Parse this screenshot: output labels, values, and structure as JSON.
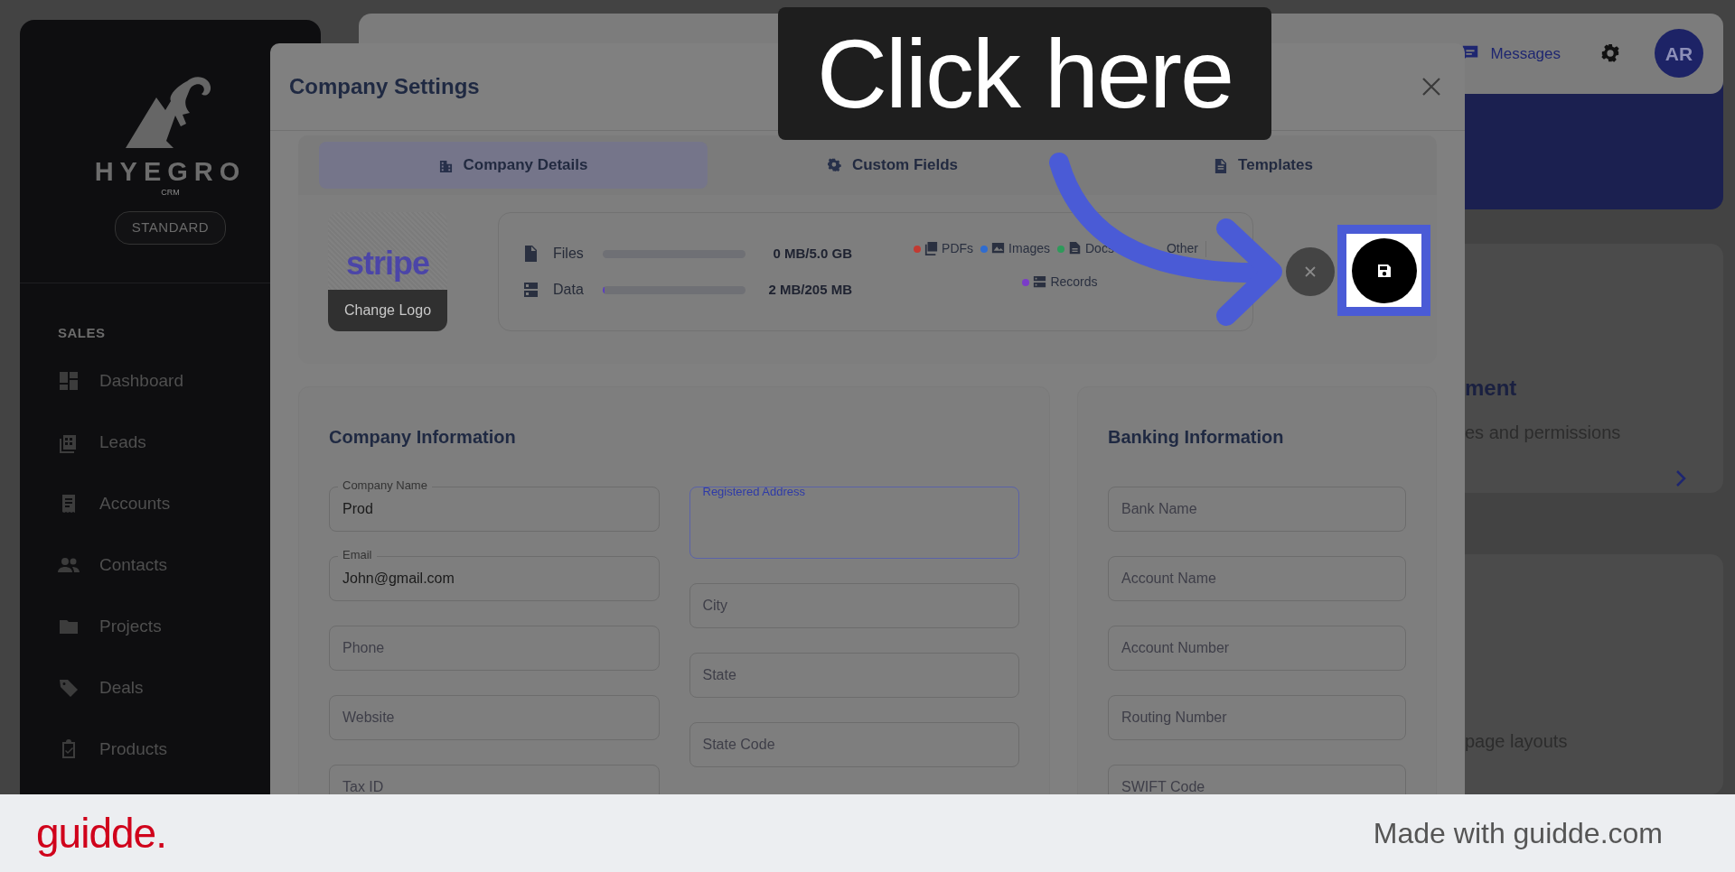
{
  "sidebar": {
    "logo": "HYEGRO",
    "logo_sub": "CRM",
    "plan": "STANDARD",
    "section": "SALES",
    "items": [
      {
        "label": "Dashboard"
      },
      {
        "label": "Leads"
      },
      {
        "label": "Accounts"
      },
      {
        "label": "Contacts"
      },
      {
        "label": "Projects"
      },
      {
        "label": "Deals"
      },
      {
        "label": "Products"
      }
    ]
  },
  "header": {
    "messages": "Messages",
    "avatar": "AR"
  },
  "background_cards": [
    {
      "title": "ment",
      "subtitle": "es and permissions"
    },
    {
      "subtitle": "page layouts"
    }
  ],
  "modal": {
    "title": "Company Settings",
    "tabs": [
      {
        "label": "Company Details",
        "selected": true
      },
      {
        "label": "Custom Fields",
        "selected": false
      },
      {
        "label": "Templates",
        "selected": false
      }
    ],
    "logo": {
      "brand": "stripe",
      "button": "Change Logo"
    },
    "storage": [
      {
        "label": "Files",
        "level": 0,
        "reading": "0 MB/5.0 GB"
      },
      {
        "label": "Data",
        "level": 0.01,
        "reading": "2 MB/205 MB"
      }
    ],
    "legend": [
      {
        "label": "PDFs",
        "color": "#c23a32"
      },
      {
        "label": "Images",
        "color": "#2f6cd0"
      },
      {
        "label": "Docs",
        "color": "#2e9a5a"
      },
      {
        "label": "Other"
      },
      {
        "label": "Records",
        "color": "#7a3cc8"
      }
    ],
    "sections": [
      {
        "title": "Company Information",
        "columns": [
          [
            {
              "label": "Company Name",
              "value": "Prod",
              "focused": false
            },
            {
              "label": "Email",
              "value": "John@gmail.com",
              "focused": false
            },
            {
              "placeholder": "Phone",
              "focused": false
            },
            {
              "placeholder": "Website",
              "focused": false
            },
            {
              "placeholder": "Tax ID",
              "focused": false
            }
          ],
          [
            {
              "label": "Registered Address",
              "kind": "textarea",
              "focused": true
            },
            {
              "placeholder": "City",
              "focused": false
            },
            {
              "placeholder": "State",
              "focused": false
            },
            {
              "placeholder": "State Code",
              "focused": false
            }
          ]
        ]
      },
      {
        "title": "Banking Information",
        "columns": [
          [
            {
              "placeholder": "Bank Name",
              "focused": false
            },
            {
              "placeholder": "Account Name",
              "focused": false
            },
            {
              "placeholder": "Account Number",
              "focused": false
            },
            {
              "placeholder": "Routing Number",
              "focused": false
            },
            {
              "placeholder": "SWIFT Code",
              "focused": false
            }
          ]
        ]
      }
    ]
  },
  "callout": {
    "text": "Click here"
  },
  "footer": {
    "brand": "guidde.",
    "credit": "Made with guidde.com"
  }
}
